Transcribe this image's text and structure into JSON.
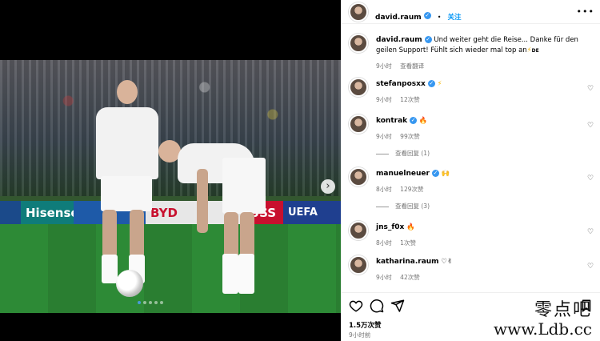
{
  "post": {
    "author": "david.raum",
    "follow_label": "关注",
    "more_label": "•••",
    "caption": {
      "username": "david.raum",
      "text": "Und weiter geht die Reise... Danke für den geilen Support! Fühlt sich wieder mal top an",
      "emoji": "⚡",
      "flag": "DE",
      "time": "9小时",
      "translate_label": "查看翻译"
    },
    "media": {
      "next_icon": "chevron-right-icon",
      "slide_count": 5,
      "active_slide": 1,
      "board_texts": [
        "Hisense",
        "BYD",
        "USS",
        "UEFA EUR"
      ]
    },
    "comments": [
      {
        "username": "stefanposxx",
        "verified": true,
        "emoji": "⚡",
        "time": "9小时",
        "likes": "12次赞"
      },
      {
        "username": "kontrak",
        "verified": true,
        "emoji": "🔥",
        "time": "9小时",
        "likes": "99次赞",
        "replies": "查看回复 (1)"
      },
      {
        "username": "manuelneuer",
        "verified": true,
        "emoji": "🙌",
        "time": "8小时",
        "likes": "129次赞",
        "replies": "查看回复 (3)"
      },
      {
        "username": "jns_f0x",
        "verified": false,
        "emoji": "🔥",
        "time": "8小时",
        "likes": "1次赞"
      },
      {
        "username": "katharina.raum",
        "verified": false,
        "emoji": "♡✌",
        "time": "9小时",
        "likes": "42次赞"
      }
    ],
    "likes_total": "1.5万次赞",
    "posted_ago": "9小时前"
  },
  "watermark": {
    "cn": "零点吧",
    "url": "www.Ldb.cc"
  },
  "colors": {
    "accent": "#0095f6",
    "verified": "#3797f0",
    "muted": "#737373"
  }
}
